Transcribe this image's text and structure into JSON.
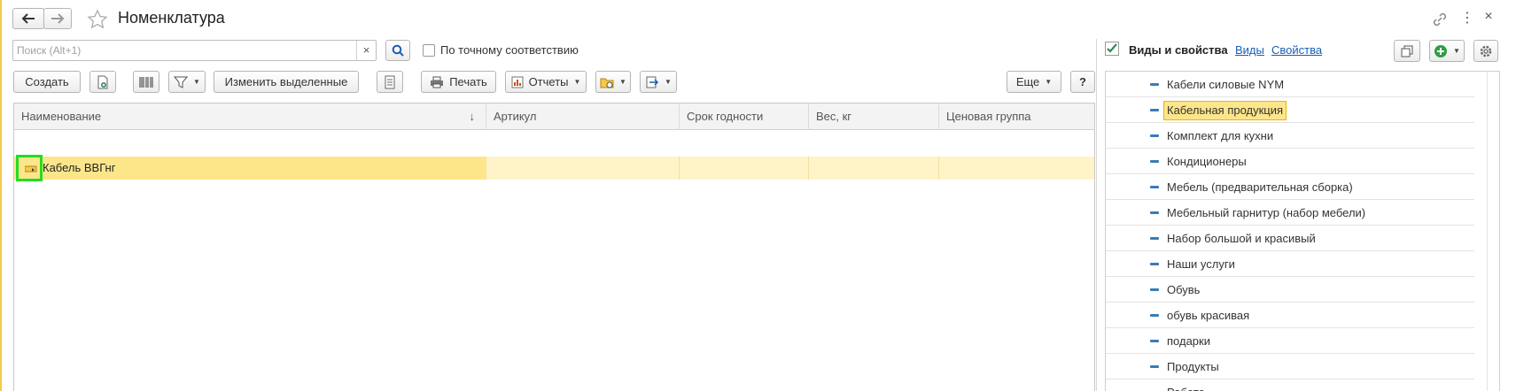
{
  "window": {
    "title": "Номенклатура"
  },
  "search": {
    "placeholder": "Поиск (Alt+1)",
    "clear": "×",
    "exact_match_label": "По точному соответствию"
  },
  "toolbar": {
    "create": "Создать",
    "change_selected": "Изменить выделенные",
    "print": "Печать",
    "reports": "Отчеты",
    "more": "Еще",
    "help": "?"
  },
  "table": {
    "columns": [
      "Наименование",
      "Артикул",
      "Срок годности",
      "Вес, кг",
      "Ценовая группа"
    ],
    "sort_indicator": "↓",
    "rows": [
      {
        "name": "Кабель ВВГнг",
        "article": "",
        "shelf_life": "",
        "weight": "",
        "price_group": ""
      }
    ]
  },
  "side_panel": {
    "title": "Виды и свойства",
    "link_kinds": "Виды",
    "link_properties": "Свойства",
    "items": [
      "Кабели силовые NYM",
      "Кабельная продукция",
      "Комплект для кухни",
      "Кондиционеры",
      "Мебель (предварительная сборка)",
      "Мебельный гарнитур (набор мебели)",
      "Набор большой и красивый",
      "Наши услуги",
      "Обувь",
      "обувь красивая",
      "подарки",
      "Продукты",
      "Работа"
    ],
    "selected_index": 1
  },
  "colors": {
    "selected_row": "#fde68a",
    "highlight_border": "#22dd22",
    "link": "#1a5fb4",
    "check": "#2e8b57"
  }
}
